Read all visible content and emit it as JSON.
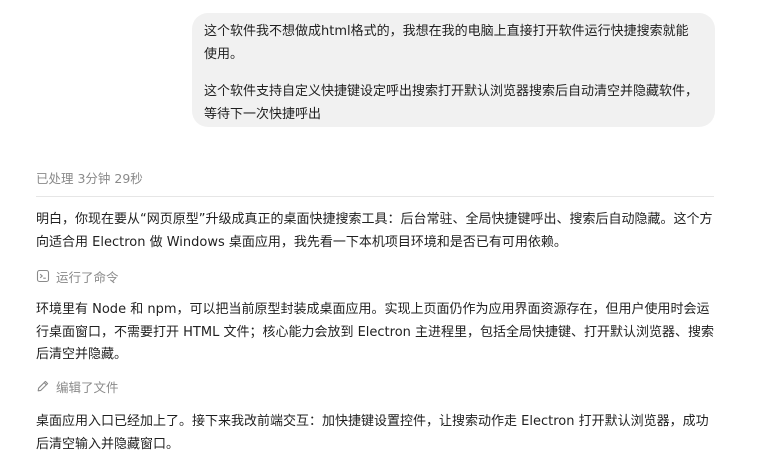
{
  "user_message": {
    "paragraph_1": "这个软件我不想做成html格式的，我想在我的电脑上直接打开软件运行快捷搜索就能使用。",
    "paragraph_2": "这个软件支持自定义快捷键设定呼出搜索打开默认浏览器搜索后自动清空并隐藏软件，等待下一次快捷呼出"
  },
  "assistant": {
    "status": "已处理 3分钟 29秒",
    "paragraph_1": "明白，你现在要从“网页原型”升级成真正的桌面快捷搜索工具：后台常驻、全局快捷键呼出、搜索后自动隐藏。这个方向适合用 Electron 做 Windows 桌面应用，我先看一下本机项目环境和是否已有可用依赖。",
    "action_1": {
      "icon": "terminal-icon",
      "label": "运行了命令"
    },
    "paragraph_2": "环境里有 Node 和 npm，可以把当前原型封装成桌面应用。实现上页面仍作为应用界面资源存在，但用户使用时会运行桌面窗口，不需要打开 HTML 文件；核心能力会放到 Electron 主进程里，包括全局快捷键、打开默认浏览器、搜索后清空并隐藏。",
    "action_2": {
      "icon": "pencil-icon",
      "label": "编辑了文件"
    },
    "paragraph_3": "桌面应用入口已经加上了。接下来我改前端交互：加快捷键设置控件，让搜索动作走 Electron 打开默认浏览器，成功后清空输入并隐藏窗口。"
  }
}
